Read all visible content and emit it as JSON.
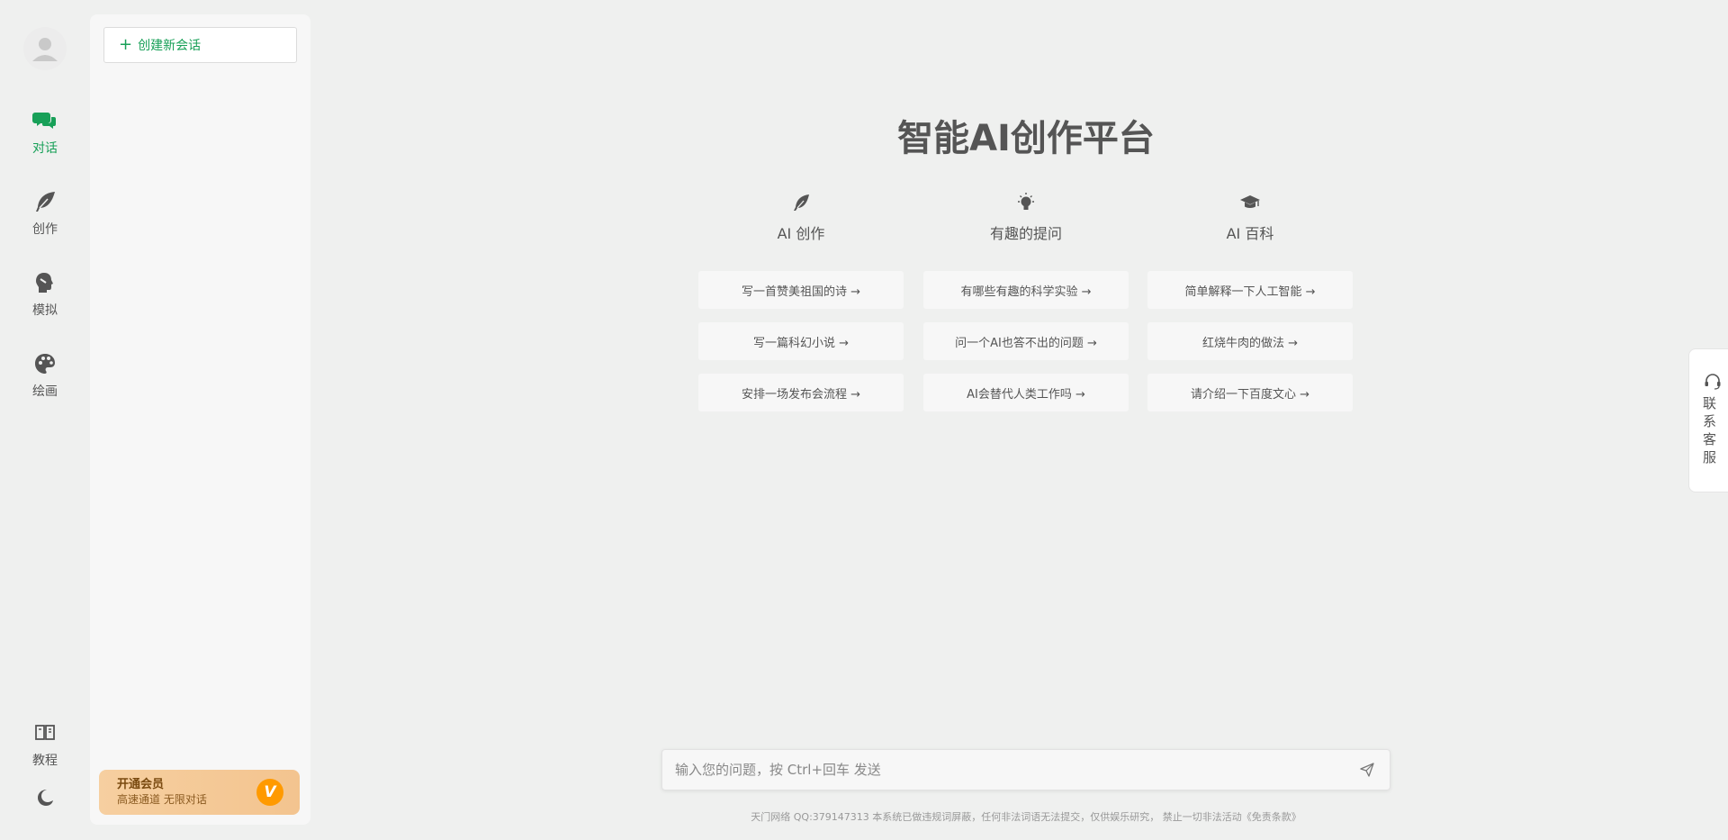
{
  "nav": {
    "items": [
      {
        "label": "对话",
        "icon": "chat-icon",
        "active": true
      },
      {
        "label": "创作",
        "icon": "feather-icon",
        "active": false
      },
      {
        "label": "模拟",
        "icon": "head-profile-icon",
        "active": false
      },
      {
        "label": "绘画",
        "icon": "palette-icon",
        "active": false
      }
    ],
    "tutorial_label": "教程"
  },
  "sidebar": {
    "new_chat_label": "创建新会话",
    "vip": {
      "title": "开通会员",
      "subtitle": "高速通道 无限对话",
      "badge": "V"
    }
  },
  "main": {
    "title": "智能AI创作平台",
    "categories": [
      {
        "label": "AI 创作",
        "icon": "feather-icon"
      },
      {
        "label": "有趣的提问",
        "icon": "lightbulb-icon"
      },
      {
        "label": "AI 百科",
        "icon": "graduation-cap-icon"
      }
    ],
    "questions": [
      [
        "写一首赞美祖国的诗 →",
        "写一篇科幻小说 →",
        "安排一场发布会流程 →"
      ],
      [
        "有哪些有趣的科学实验 →",
        "问一个AI也答不出的问题 →",
        "AI会替代人类工作吗 →"
      ],
      [
        "简单解释一下人工智能 →",
        "红烧牛肉的做法 →",
        "请介绍一下百度文心 →"
      ]
    ]
  },
  "input": {
    "placeholder": "输入您的问题，按 Ctrl+回车 发送"
  },
  "footer": {
    "text": "天门网络 QQ:379147313 本系统已做违规词屏蔽，任何非法词语无法提交，仅供娱乐研究， 禁止一切非法活动《免责条款》"
  },
  "support_tab": {
    "label": "联系客服"
  },
  "colors": {
    "accent": "#18a058",
    "background": "#eff0ef",
    "vip_gradient_start": "#f6cfa0",
    "vip_badge": "#ff9a00"
  }
}
